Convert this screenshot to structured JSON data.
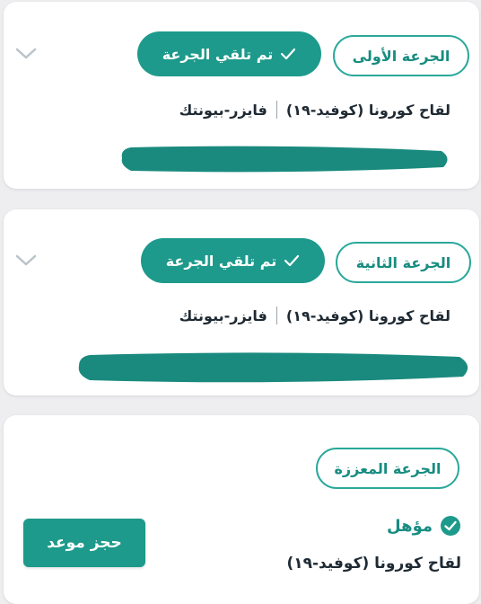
{
  "doses": [
    {
      "dose_label": "الجرعة الأولى",
      "status": "تم تلقي الجرعة",
      "vaccine": "لقاح كورونا (كوفيد-١٩)",
      "manufacturer": "فايزر-بيونتك"
    },
    {
      "dose_label": "الجرعة الثانية",
      "status": "تم تلقي الجرعة",
      "vaccine": "لقاح كورونا (كوفيد-١٩)",
      "manufacturer": "فايزر-بيونتك"
    }
  ],
  "booster": {
    "dose_label": "الجرعة المعززة",
    "eligibility": "مؤهل",
    "vaccine": "لقاح كورونا (كوفيد-١٩)",
    "book_button": "حجز موعد"
  },
  "colors": {
    "accent": "#1d9a8b",
    "accent_text": "#178c80",
    "redaction": "#1a8a7e"
  },
  "icons": [
    "check-icon",
    "chevron-down-icon",
    "check-circle-icon"
  ]
}
